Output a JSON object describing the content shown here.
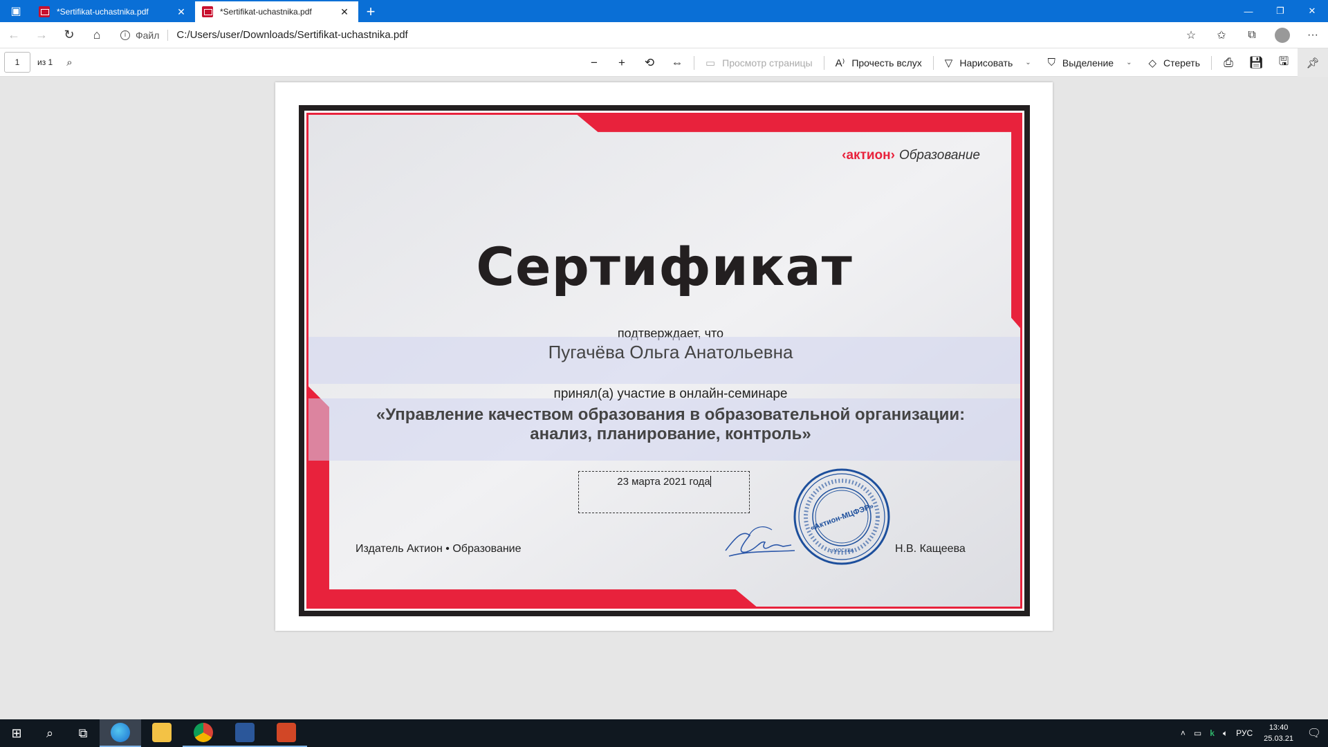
{
  "browser": {
    "tabs": [
      {
        "title": "*Sertifikat-uchastnika.pdf",
        "active": false
      },
      {
        "title": "*Sertifikat-uchastnika.pdf",
        "active": true
      }
    ],
    "new_tab": "+",
    "address": {
      "scheme_label": "Файл",
      "url": "C:/Users/user/Downloads/Sertifikat-uchastnika.pdf"
    }
  },
  "pdf_toolbar": {
    "page_current": "1",
    "page_of": "из 1",
    "page_view": "Просмотр страницы",
    "read_aloud": "Прочесть вслух",
    "draw": "Нарисовать",
    "highlight": "Выделение",
    "erase": "Стереть"
  },
  "certificate": {
    "logo_brand": "‹актион›",
    "logo_text": "Образование",
    "title": "Сертификат",
    "confirms": "подтверждает, что",
    "name": "Пугачёва Ольга Анатольевна",
    "participated": "принял(а) участие в онлайн-семинаре",
    "seminar_line1": "«Управление качеством образования в образовательной организации:",
    "seminar_line2": "анализ, планирование, контроль»",
    "date": "23 марта  2021 года",
    "publisher": "Издатель Актион • Образование",
    "signer": "Н.В. Кащеева",
    "stamp_text": "«Актион-МЦФЭР»",
    "stamp_city": "г. МОСКВА"
  },
  "taskbar": {
    "language": "РУС",
    "time": "13:40",
    "date": "25.03.21"
  },
  "colors": {
    "accent_blue": "#0a6fd6",
    "cert_red": "#e8223c",
    "cert_dark": "#231f20",
    "stamp_blue": "#1d4f9c"
  }
}
